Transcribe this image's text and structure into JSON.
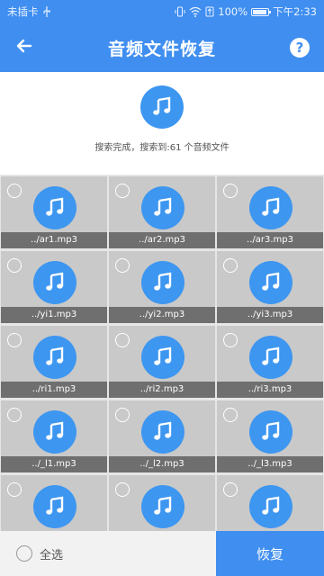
{
  "status_bar": {
    "carrier": "未插卡",
    "battery_percent": "100%",
    "time": "下午2:33"
  },
  "header": {
    "title": "音频文件恢复",
    "back_icon": "arrow-left-icon",
    "help_icon": "help-icon",
    "help_glyph": "?"
  },
  "summary": {
    "text": "搜索完成，搜索到:61 个音频文件",
    "icon": "music-note-icon"
  },
  "files": [
    {
      "label": "../ar1.mp3"
    },
    {
      "label": "../ar2.mp3"
    },
    {
      "label": "../ar3.mp3"
    },
    {
      "label": "../yi1.mp3"
    },
    {
      "label": "../yi2.mp3"
    },
    {
      "label": "../yi3.mp3"
    },
    {
      "label": "../ri1.mp3"
    },
    {
      "label": "../ri2.mp3"
    },
    {
      "label": "../ri3.mp3"
    },
    {
      "label": "../_l1.mp3"
    },
    {
      "label": "../_l2.mp3"
    },
    {
      "label": "../_l3.mp3"
    },
    {
      "label": ""
    },
    {
      "label": ""
    },
    {
      "label": ""
    }
  ],
  "bottom_bar": {
    "select_all_label": "全选",
    "recover_label": "恢复"
  },
  "colors": {
    "primary": "#3f8ef0",
    "icon_blue": "#3d96f0",
    "tile_gray": "#c9c9c9",
    "label_bar": "#6f6f6f"
  }
}
